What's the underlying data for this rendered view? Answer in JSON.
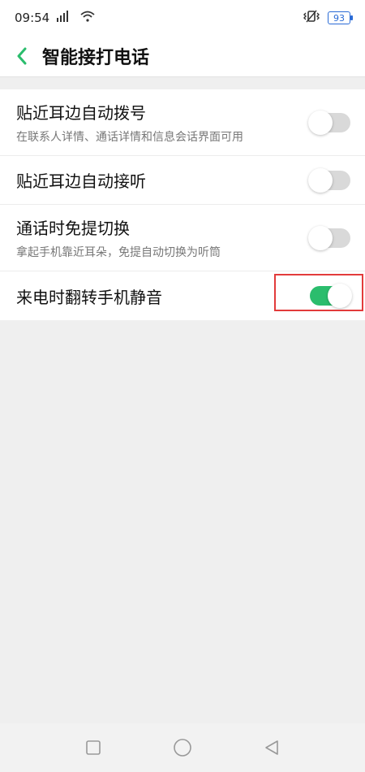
{
  "status": {
    "time": "09:54",
    "signal_label": "4G",
    "battery": "93",
    "icons": [
      "signal-icon",
      "wifi-icon",
      "vibrate-icon",
      "battery-icon"
    ]
  },
  "header": {
    "title": "智能接打电话"
  },
  "settings": [
    {
      "title": "贴近耳边自动拨号",
      "subtitle": "在联系人详情、通话详情和信息会话界面可用",
      "enabled": false
    },
    {
      "title": "贴近耳边自动接听",
      "subtitle": "",
      "enabled": false
    },
    {
      "title": "通话时免提切换",
      "subtitle": "拿起手机靠近耳朵，免提自动切换为听筒",
      "enabled": false
    },
    {
      "title": "来电时翻转手机静音",
      "subtitle": "",
      "enabled": true
    }
  ],
  "colors": {
    "accent": "#2bbd6d",
    "highlight": "#e23b3b",
    "toggle_off": "#d9d9d9"
  },
  "nav": [
    "recent-apps-icon",
    "home-icon",
    "back-triangle-icon"
  ]
}
